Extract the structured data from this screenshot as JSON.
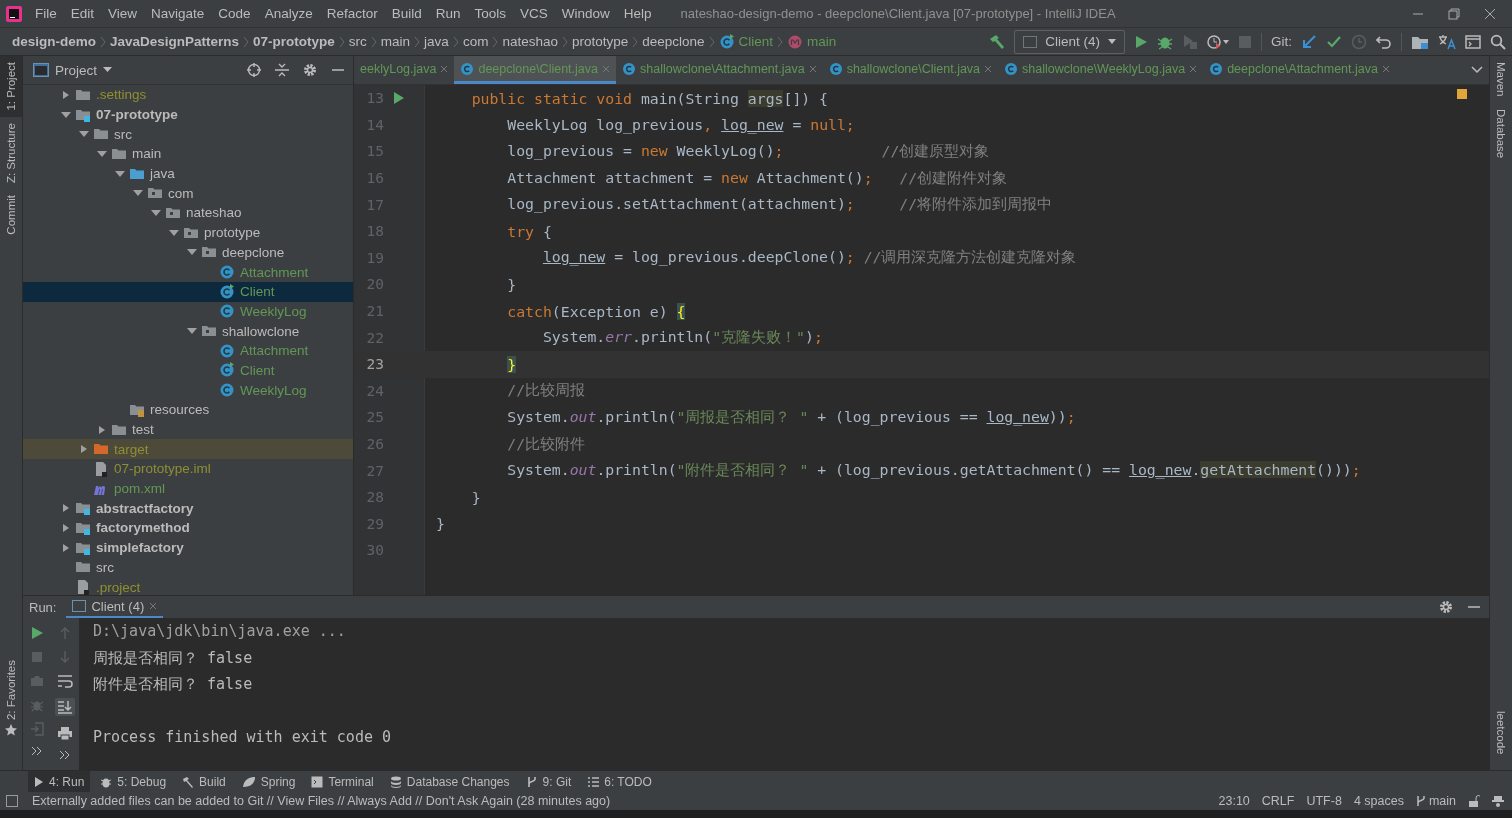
{
  "window": {
    "title": "nateshao-design-demo - deepclone\\Client.java [07-prototype] - IntelliJ IDEA"
  },
  "menu": [
    "File",
    "Edit",
    "View",
    "Navigate",
    "Code",
    "Analyze",
    "Refactor",
    "Build",
    "Run",
    "Tools",
    "VCS",
    "Window",
    "Help"
  ],
  "breadcrumb": [
    {
      "label": "design-demo",
      "kind": "module"
    },
    {
      "label": "JavaDesignPatterns",
      "kind": "module"
    },
    {
      "label": "07-prototype",
      "kind": "module"
    },
    {
      "label": "src",
      "kind": "folder"
    },
    {
      "label": "main",
      "kind": "folder"
    },
    {
      "label": "java",
      "kind": "folder"
    },
    {
      "label": "com",
      "kind": "folder"
    },
    {
      "label": "nateshao",
      "kind": "folder"
    },
    {
      "label": "prototype",
      "kind": "folder"
    },
    {
      "label": "deepclone",
      "kind": "folder"
    },
    {
      "label": "Client",
      "kind": "class"
    },
    {
      "label": "main",
      "kind": "method"
    }
  ],
  "toolbar": {
    "run_config": "Client (4)",
    "git_label": "Git:"
  },
  "left_stripe": [
    {
      "label": "1: Project",
      "selected": true
    },
    {
      "label": "Z: Structure",
      "selected": false
    },
    {
      "label": "Commit",
      "selected": false
    }
  ],
  "left_stripe_bottom": [
    {
      "label": "2: Favorites",
      "selected": false
    }
  ],
  "right_stripe": [
    "Maven",
    "Database"
  ],
  "right_stripe_bottom": [
    "leetcode"
  ],
  "project_panel": {
    "title": "Project",
    "tree": [
      {
        "label": ".settings",
        "kind": "folder",
        "color": "#8f8f32",
        "expanded": false,
        "selected": false
      },
      {
        "label": "07-prototype",
        "kind": "module",
        "expanded": true,
        "selected": false,
        "children": [
          {
            "label": "src",
            "kind": "folder",
            "expanded": true,
            "selected": false,
            "children": [
              {
                "label": "main",
                "kind": "folder",
                "expanded": true,
                "selected": false,
                "children": [
                  {
                    "label": "java",
                    "kind": "source_folder",
                    "expanded": true,
                    "selected": false,
                    "children": [
                      {
                        "label": "com",
                        "kind": "package",
                        "expanded": true,
                        "selected": false,
                        "children": [
                          {
                            "label": "nateshao",
                            "kind": "package",
                            "expanded": true,
                            "selected": false,
                            "children": [
                              {
                                "label": "prototype",
                                "kind": "package",
                                "expanded": true,
                                "selected": false,
                                "children": [
                                  {
                                    "label": "deepclone",
                                    "kind": "package",
                                    "expanded": true,
                                    "selected": false,
                                    "children": [
                                      {
                                        "label": "Attachment",
                                        "kind": "class",
                                        "color": "#629755",
                                        "selected": false
                                      },
                                      {
                                        "label": "Client",
                                        "kind": "runnable_class",
                                        "color": "#629755",
                                        "selected": true
                                      },
                                      {
                                        "label": "WeeklyLog",
                                        "kind": "class",
                                        "color": "#629755",
                                        "selected": false
                                      }
                                    ]
                                  },
                                  {
                                    "label": "shallowclone",
                                    "kind": "package",
                                    "expanded": true,
                                    "selected": false,
                                    "children": [
                                      {
                                        "label": "Attachment",
                                        "kind": "class",
                                        "color": "#629755",
                                        "selected": false
                                      },
                                      {
                                        "label": "Client",
                                        "kind": "runnable_class",
                                        "color": "#629755",
                                        "selected": false
                                      },
                                      {
                                        "label": "WeeklyLog",
                                        "kind": "class",
                                        "color": "#629755",
                                        "selected": false
                                      }
                                    ]
                                  }
                                ]
                              }
                            ]
                          }
                        ]
                      }
                    ]
                  },
                  {
                    "label": "resources",
                    "kind": "resources_folder",
                    "selected": false
                  }
                ]
              },
              {
                "label": "test",
                "kind": "folder",
                "expanded": false,
                "selected": false
              }
            ]
          },
          {
            "label": "target",
            "kind": "excluded_folder",
            "color": "#8f8f32",
            "expanded": false,
            "selected": false
          },
          {
            "label": "07-prototype.iml",
            "kind": "file",
            "color": "#8f8f32",
            "selected": false
          },
          {
            "label": "pom.xml",
            "kind": "maven_file",
            "color": "#629755",
            "selected": false
          }
        ]
      },
      {
        "label": "abstractfactory",
        "kind": "module",
        "expanded": false,
        "selected": false
      },
      {
        "label": "factorymethod",
        "kind": "module",
        "expanded": false,
        "selected": false
      },
      {
        "label": "simplefactory",
        "kind": "module",
        "expanded": false,
        "selected": false
      },
      {
        "label": "src",
        "kind": "folder",
        "selected": false
      },
      {
        "label": ".project",
        "kind": "file",
        "color": "#8f8f32",
        "selected": false
      }
    ]
  },
  "editor": {
    "tabs": [
      {
        "label": "eeklyLog.java",
        "selected": false
      },
      {
        "label": "deepclone\\Client.java",
        "selected": true
      },
      {
        "label": "shallowclone\\Attachment.java",
        "selected": false
      },
      {
        "label": "shallowclone\\Client.java",
        "selected": false
      },
      {
        "label": "shallowclone\\WeeklyLog.java",
        "selected": false
      },
      {
        "label": "deepclone\\Attachment.java",
        "selected": false
      }
    ],
    "lines": [
      {
        "number": "13",
        "current": false,
        "run": true,
        "segments": [
          {
            "t": "    public static void",
            "kind": "kw"
          },
          {
            "t": " main(String ",
            "kind": "plain"
          },
          {
            "t": "args",
            "kind": "hl"
          },
          {
            "t": "[]) {",
            "kind": "plain"
          }
        ]
      },
      {
        "number": "14",
        "current": false,
        "run": false,
        "segments": [
          {
            "t": "        WeeklyLog log_previous",
            "kind": "plain"
          },
          {
            "t": ", ",
            "kind": "kw"
          },
          {
            "t": "log_new",
            "kind": "var"
          },
          {
            "t": " = ",
            "kind": "plain"
          },
          {
            "t": "null;",
            "kind": "kw"
          }
        ]
      },
      {
        "number": "15",
        "current": false,
        "run": false,
        "segments": [
          {
            "t": "        log_previous = ",
            "kind": "plain"
          },
          {
            "t": "new",
            "kind": "kw"
          },
          {
            "t": " WeeklyLog()",
            "kind": "plain"
          },
          {
            "t": ";",
            "kind": "kw"
          },
          {
            "t": "           //创建原型对象",
            "kind": "cmt"
          }
        ]
      },
      {
        "number": "16",
        "current": false,
        "run": false,
        "segments": [
          {
            "t": "        Attachment attachment = ",
            "kind": "plain"
          },
          {
            "t": "new",
            "kind": "kw"
          },
          {
            "t": " Attachment()",
            "kind": "plain"
          },
          {
            "t": ";",
            "kind": "kw"
          },
          {
            "t": "   //创建附件对象",
            "kind": "cmt"
          }
        ]
      },
      {
        "number": "17",
        "current": false,
        "run": false,
        "segments": [
          {
            "t": "        log_previous.setAttachment(attachment)",
            "kind": "plain"
          },
          {
            "t": ";",
            "kind": "kw"
          },
          {
            "t": "     //将附件添加到周报中",
            "kind": "cmt"
          }
        ]
      },
      {
        "number": "18",
        "current": false,
        "run": false,
        "segments": [
          {
            "t": "        try",
            "kind": "kw"
          },
          {
            "t": " {",
            "kind": "plain"
          }
        ]
      },
      {
        "number": "19",
        "current": false,
        "run": false,
        "segments": [
          {
            "t": "            log_new",
            "kind": "var"
          },
          {
            "t": " = log_previous.deepClone()",
            "kind": "plain"
          },
          {
            "t": ";",
            "kind": "kw"
          },
          {
            "t": " //调用深克隆方法创建克隆对象",
            "kind": "cmt"
          }
        ]
      },
      {
        "number": "20",
        "current": false,
        "run": false,
        "segments": [
          {
            "t": "        }",
            "kind": "plain"
          }
        ]
      },
      {
        "number": "21",
        "current": false,
        "run": false,
        "segments": [
          {
            "t": "        catch",
            "kind": "kw"
          },
          {
            "t": "(Exception e) ",
            "kind": "plain"
          },
          {
            "t": "{",
            "kind": "brace"
          }
        ]
      },
      {
        "number": "22",
        "current": false,
        "run": false,
        "segments": [
          {
            "t": "            System.",
            "kind": "plain"
          },
          {
            "t": "err",
            "kind": "fld"
          },
          {
            "t": ".println(",
            "kind": "plain"
          },
          {
            "t": "\"克隆失败！\"",
            "kind": "str"
          },
          {
            "t": ")",
            "kind": "plain"
          },
          {
            "t": ";",
            "kind": "kw"
          }
        ]
      },
      {
        "number": "23",
        "current": true,
        "run": false,
        "segments": [
          {
            "t": "        }",
            "kind": "brace"
          }
        ]
      },
      {
        "number": "24",
        "current": false,
        "run": false,
        "segments": [
          {
            "t": "        //比较周报",
            "kind": "cmt"
          }
        ]
      },
      {
        "number": "25",
        "current": false,
        "run": false,
        "segments": [
          {
            "t": "        System.",
            "kind": "plain"
          },
          {
            "t": "out",
            "kind": "fld"
          },
          {
            "t": ".println(",
            "kind": "plain"
          },
          {
            "t": "\"周报是否相同？ \"",
            "kind": "str"
          },
          {
            "t": " + (log_previous == ",
            "kind": "plain"
          },
          {
            "t": "log_new",
            "kind": "var"
          },
          {
            "t": "))",
            "kind": "plain"
          },
          {
            "t": ";",
            "kind": "kw"
          }
        ]
      },
      {
        "number": "26",
        "current": false,
        "run": false,
        "segments": [
          {
            "t": "        //比较附件",
            "kind": "cmt"
          }
        ]
      },
      {
        "number": "27",
        "current": false,
        "run": false,
        "segments": [
          {
            "t": "        System.",
            "kind": "plain"
          },
          {
            "t": "out",
            "kind": "fld"
          },
          {
            "t": ".println(",
            "kind": "plain"
          },
          {
            "t": "\"附件是否相同？ \"",
            "kind": "str"
          },
          {
            "t": " + (log_previous.getAttachment() == ",
            "kind": "plain"
          },
          {
            "t": "log_new",
            "kind": "var"
          },
          {
            "t": ".",
            "kind": "plain"
          },
          {
            "t": "getAttachment",
            "kind": "hl"
          },
          {
            "t": "()))",
            "kind": "plain"
          },
          {
            "t": ";",
            "kind": "kw"
          }
        ]
      },
      {
        "number": "28",
        "current": false,
        "run": false,
        "segments": [
          {
            "t": "    }",
            "kind": "plain"
          }
        ]
      },
      {
        "number": "29",
        "current": false,
        "run": false,
        "segments": [
          {
            "t": "}",
            "kind": "plain"
          }
        ]
      },
      {
        "number": "30",
        "current": false,
        "run": false
      }
    ]
  },
  "run_panel": {
    "label": "Run:",
    "tab": "Client (4)",
    "console": [
      {
        "text": "D:\\java\\jdk\\bin\\java.exe ...",
        "kind": "command"
      },
      {
        "text": "周报是否相同？ false",
        "kind": "output"
      },
      {
        "text": "附件是否相同？ false",
        "kind": "output"
      },
      {
        "text": "Process finished with exit code 0",
        "kind": "exit"
      }
    ]
  },
  "tool_tabs": [
    {
      "label": "4: Run",
      "kind": "run",
      "selected": true
    },
    {
      "label": "5: Debug",
      "kind": "debug",
      "selected": false
    },
    {
      "label": "Build",
      "kind": "build",
      "selected": false
    },
    {
      "label": "Spring",
      "kind": "spring",
      "selected": false
    },
    {
      "label": "Terminal",
      "kind": "terminal",
      "selected": false
    },
    {
      "label": "Database Changes",
      "kind": "database",
      "selected": false
    },
    {
      "label": "9: Git",
      "kind": "git",
      "selected": false
    },
    {
      "label": "6: TODO",
      "kind": "todo",
      "selected": false
    }
  ],
  "status_bar": {
    "message": "Externally added files can be added to Git // View Files // Always Add // Don't Ask Again (28 minutes ago)",
    "position": "23:10",
    "line_separator": "CRLF",
    "encoding": "UTF-8",
    "indent": "4 spaces",
    "branch": "main"
  }
}
